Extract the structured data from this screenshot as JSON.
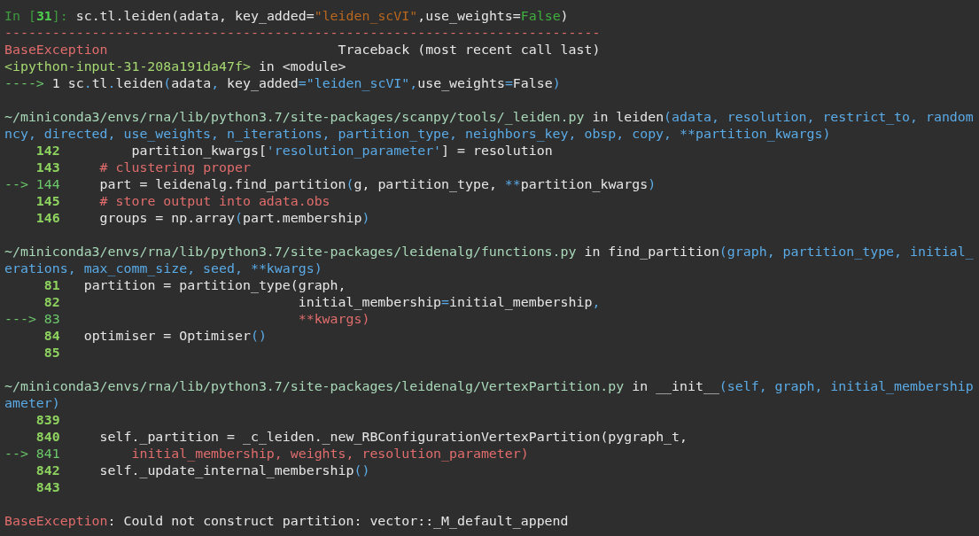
{
  "terminal": {
    "blocks": [
      {
        "lines": [
          {
            "segments": [
              {
                "text": "In [",
                "kind": "prompt"
              },
              {
                "text": "31",
                "kind": "prompt_num"
              },
              {
                "text": "]: ",
                "kind": "prompt"
              },
              {
                "text": "sc.tl.leiden(adata, key_added=",
                "kind": "plain"
              },
              {
                "text": "\"leiden_scVI\"",
                "kind": "string"
              },
              {
                "text": ",use_weights=",
                "kind": "plain"
              },
              {
                "text": "False",
                "kind": "keyword"
              },
              {
                "text": ")",
                "kind": "plain"
              }
            ]
          },
          {
            "segments": [
              {
                "text": "---------------------------------------------------------------------------",
                "kind": "rule"
              }
            ]
          },
          {
            "segments": [
              {
                "text": "BaseException",
                "kind": "error"
              },
              {
                "text": "                             Traceback (most recent call last)",
                "kind": "plain"
              }
            ]
          },
          {
            "segments": [
              {
                "text": "<ipython-input-31-208a191da47f>",
                "kind": "location"
              },
              {
                "text": " in <module>",
                "kind": "plain"
              }
            ]
          },
          {
            "segments": [
              {
                "text": "----> ",
                "kind": "arrow"
              },
              {
                "text": "1 sc",
                "kind": "plain"
              },
              {
                "text": ".",
                "kind": "op"
              },
              {
                "text": "tl",
                "kind": "plain"
              },
              {
                "text": ".",
                "kind": "op"
              },
              {
                "text": "leiden",
                "kind": "plain"
              },
              {
                "text": "(",
                "kind": "op"
              },
              {
                "text": "adata",
                "kind": "plain"
              },
              {
                "text": ",",
                "kind": "op"
              },
              {
                "text": " key_added",
                "kind": "plain"
              },
              {
                "text": "=",
                "kind": "op"
              },
              {
                "text": "\"leiden_scVI\"",
                "kind": "op"
              },
              {
                "text": ",",
                "kind": "op"
              },
              {
                "text": "use_weights",
                "kind": "plain"
              },
              {
                "text": "=",
                "kind": "op"
              },
              {
                "text": "False",
                "kind": "plain"
              },
              {
                "text": ")",
                "kind": "op"
              }
            ]
          }
        ]
      },
      {
        "lines": [
          {
            "segments": [
              {
                "text": "~/miniconda3/envs/rna/lib/python3.7/site-packages/scanpy/tools/_leiden.py",
                "kind": "path"
              },
              {
                "text": " in leiden",
                "kind": "plain"
              },
              {
                "text": "(adata, resolution, restrict_to, random",
                "kind": "op"
              }
            ]
          },
          {
            "segments": [
              {
                "text": "ncy, directed, use_weights, n_iterations, partition_type, neighbors_key, obsp, copy, **partition_kwargs)",
                "kind": "op"
              }
            ]
          },
          {
            "segments": [
              {
                "text": "    142",
                "kind": "lineno"
              },
              {
                "text": "         partition_kwargs[",
                "kind": "plain"
              },
              {
                "text": "'resolution_parameter'",
                "kind": "op"
              },
              {
                "text": "] = resolution",
                "kind": "plain"
              }
            ]
          },
          {
            "segments": [
              {
                "text": "    143",
                "kind": "lineno"
              },
              {
                "text": "     # clustering proper",
                "kind": "comment"
              }
            ]
          },
          {
            "segments": [
              {
                "text": "--> 144",
                "kind": "arrow"
              },
              {
                "text": "     part = leidenalg.find_partition",
                "kind": "plain"
              },
              {
                "text": "(",
                "kind": "op"
              },
              {
                "text": "g, partition_type, ",
                "kind": "plain"
              },
              {
                "text": "**",
                "kind": "op"
              },
              {
                "text": "partition_kwargs",
                "kind": "plain"
              },
              {
                "text": ")",
                "kind": "op"
              }
            ]
          },
          {
            "segments": [
              {
                "text": "    145",
                "kind": "lineno"
              },
              {
                "text": "     # store output into adata.obs",
                "kind": "comment"
              }
            ]
          },
          {
            "segments": [
              {
                "text": "    146",
                "kind": "lineno"
              },
              {
                "text": "     groups = np.array",
                "kind": "plain"
              },
              {
                "text": "(",
                "kind": "op"
              },
              {
                "text": "part.membership",
                "kind": "plain"
              },
              {
                "text": ")",
                "kind": "op"
              }
            ]
          }
        ]
      },
      {
        "lines": [
          {
            "segments": [
              {
                "text": "~/miniconda3/envs/rna/lib/python3.7/site-packages/leidenalg/functions.py",
                "kind": "path"
              },
              {
                "text": " in find_partition",
                "kind": "plain"
              },
              {
                "text": "(graph, partition_type, initial_",
                "kind": "op"
              }
            ]
          },
          {
            "segments": [
              {
                "text": "erations, max_comm_size, seed, **kwargs)",
                "kind": "op"
              }
            ]
          },
          {
            "segments": [
              {
                "text": "     81",
                "kind": "lineno"
              },
              {
                "text": "   partition = partition_type(graph,",
                "kind": "plain"
              }
            ]
          },
          {
            "segments": [
              {
                "text": "     82",
                "kind": "lineno"
              },
              {
                "text": "                              initial_membership",
                "kind": "plain"
              },
              {
                "text": "=",
                "kind": "op"
              },
              {
                "text": "initial_membership",
                "kind": "plain"
              },
              {
                "text": ",",
                "kind": "op"
              }
            ]
          },
          {
            "segments": [
              {
                "text": "---> 83",
                "kind": "arrow"
              },
              {
                "text": "                              **kwargs)",
                "kind": "comment"
              }
            ]
          },
          {
            "segments": [
              {
                "text": "     84",
                "kind": "lineno"
              },
              {
                "text": "   optimiser = Optimiser",
                "kind": "plain"
              },
              {
                "text": "()",
                "kind": "op"
              }
            ]
          },
          {
            "segments": [
              {
                "text": "     85",
                "kind": "lineno"
              }
            ]
          }
        ]
      },
      {
        "lines": [
          {
            "segments": [
              {
                "text": "~/miniconda3/envs/rna/lib/python3.7/site-packages/leidenalg/VertexPartition.py",
                "kind": "path"
              },
              {
                "text": " in __init__",
                "kind": "plain"
              },
              {
                "text": "(self, graph, initial_membership",
                "kind": "op"
              }
            ]
          },
          {
            "segments": [
              {
                "text": "ameter)",
                "kind": "op"
              }
            ]
          },
          {
            "segments": [
              {
                "text": "    839",
                "kind": "lineno"
              }
            ]
          },
          {
            "segments": [
              {
                "text": "    840",
                "kind": "lineno"
              },
              {
                "text": "     self._partition = _c_leiden._new_RBConfigurationVertexPartition(pygraph_t,",
                "kind": "plain"
              }
            ]
          },
          {
            "segments": [
              {
                "text": "--> 841",
                "kind": "arrow"
              },
              {
                "text": "         initial_membership, weights, resolution_parameter)",
                "kind": "comment"
              }
            ]
          },
          {
            "segments": [
              {
                "text": "    842",
                "kind": "lineno"
              },
              {
                "text": "     self._update_internal_membership",
                "kind": "plain"
              },
              {
                "text": "()",
                "kind": "op"
              }
            ]
          },
          {
            "segments": [
              {
                "text": "    843",
                "kind": "lineno"
              }
            ]
          }
        ]
      },
      {
        "lines": [
          {
            "segments": [
              {
                "text": "BaseException",
                "kind": "error"
              },
              {
                "text": ": Could not construct partition: vector::_M_default_append",
                "kind": "plain"
              }
            ]
          }
        ]
      }
    ]
  }
}
